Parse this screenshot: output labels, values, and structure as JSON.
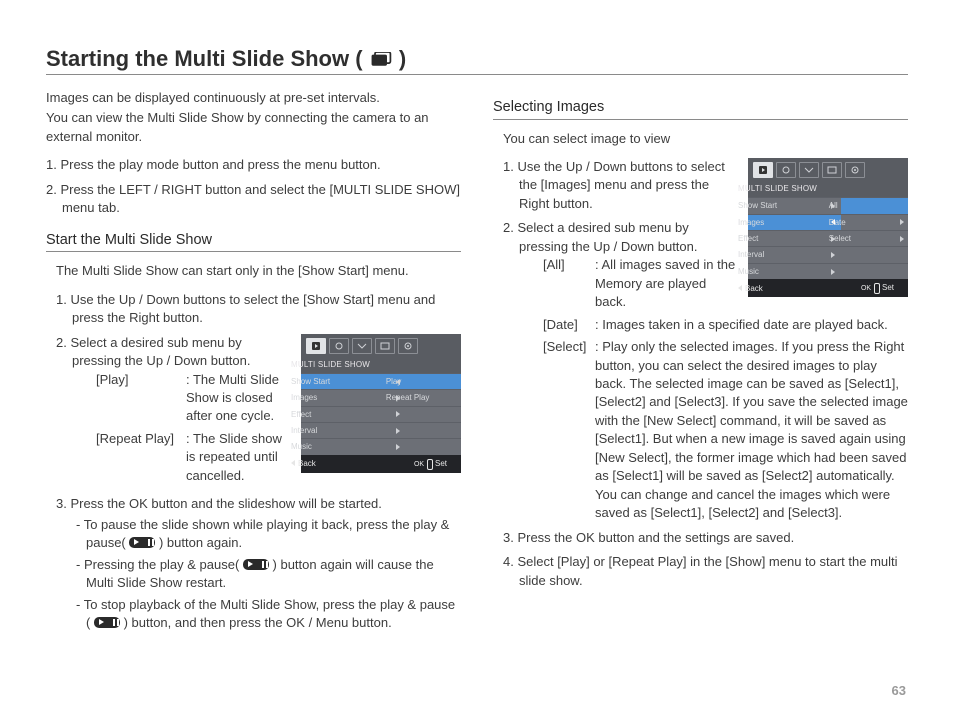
{
  "title": "Starting the Multi Slide Show (",
  "title_close": ")",
  "page_number": "63",
  "left": {
    "intro1": "Images can be displayed continuously at pre-set intervals.",
    "intro2": "You can view the Multi Slide Show by connecting the camera to an external monitor.",
    "pre_steps": [
      "1. Press the play mode button and press the menu button.",
      "2. Press the LEFT / RIGHT button and select the [MULTI SLIDE SHOW] menu tab."
    ],
    "section": "Start the Multi Slide Show",
    "lead": "The Multi Slide Show can start only in the [Show Start] menu.",
    "steps": {
      "s1": "1. Use the Up / Down buttons to select the [Show Start] menu and press the Right button.",
      "s2a": "2. Select a desired sub menu by pressing the Up / Down button.",
      "defs": [
        {
          "term": "[Play]",
          "desc": ": The Multi Slide Show is closed after one cycle."
        },
        {
          "term": "[Repeat Play]",
          "desc": ": The Slide show is repeated until cancelled."
        }
      ],
      "s3": "3. Press the OK button and the slideshow will be started.",
      "bullets": [
        "- To pause the slide shown while playing it back, press the play & pause(       ) button again.",
        "- Pressing the play & pause(       ) button again will cause the Multi Slide Show restart.",
        "- To stop playback of the Multi Slide Show, press the play & pause (       ) button, and then press the OK / Menu button."
      ]
    },
    "screen": {
      "title": "MULTI SLIDE SHOW",
      "rows": [
        {
          "label": "Show Start",
          "value": "Play",
          "sel": true
        },
        {
          "label": "Images",
          "value": "Repeat Play"
        },
        {
          "label": "Effect",
          "value": ""
        },
        {
          "label": "Interval",
          "value": ""
        },
        {
          "label": "Music",
          "value": ""
        }
      ],
      "back": "Back",
      "set": "Set",
      "ok": "OK"
    }
  },
  "right": {
    "section": "Selecting Images",
    "lead": "You can select image to view",
    "s1": "1. Use the Up / Down buttons to select the [Images] menu and press the Right button.",
    "s2": "2. Select a desired sub menu by pressing the Up / Down button.",
    "defs": [
      {
        "term": "[All]",
        "desc": ": All images saved in the Memory are played back."
      },
      {
        "term": "[Date]",
        "desc": ": Images taken in a specified date are played back."
      },
      {
        "term": "[Select]",
        "desc": ": Play only the selected images. If you press the Right button, you can select the desired images to play back. The selected image can be saved as [Select1], [Select2] and [Select3]. If you save the selected image with the [New Select] command, it will be saved as [Select1]. But when a new image is saved again using [New Select], the former image which had been saved as [Select1] will be saved as [Select2] automatically. You can change and cancel the images which were saved as [Select1], [Select2] and [Select3]."
      }
    ],
    "s3": "3. Press the OK button and the settings are saved.",
    "s4": "4. Select [Play] or [Repeat Play] in the [Show] menu to start the multi slide show.",
    "screen": {
      "title": "MULTI SLIDE SHOW",
      "rows_left": [
        "Show Start",
        "Images",
        "Effect",
        "Interval",
        "Music"
      ],
      "rows_right": [
        "All",
        "Date",
        "Select"
      ],
      "sel_index": 1,
      "back": "Back",
      "set": "Set",
      "ok": "OK"
    }
  }
}
